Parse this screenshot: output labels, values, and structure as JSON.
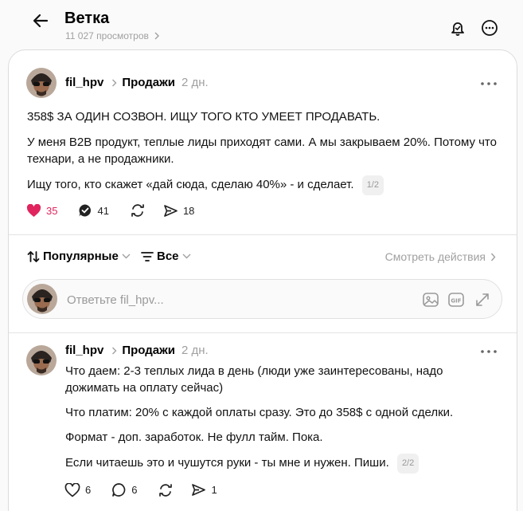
{
  "header": {
    "title": "Ветка",
    "views": "11 027 просмотров"
  },
  "post": {
    "username": "fil_hpv",
    "topic": "Продажи",
    "time": "2 дн.",
    "paragraphs": [
      "358$ ЗА ОДИН СОЗВОН. ИЩУ ТОГО КТО УМЕЕТ ПРОДАВАТЬ.",
      "У меня B2B продукт, теплые лиды приходят сами. А мы закрываем 20%. Потому что технари, а не продажники.",
      "Ищу того, кто скажет «дай сюда, сделаю 40%» - и сделает."
    ],
    "pager": "1/2",
    "likes": "35",
    "replies": "41",
    "reposts": "",
    "shares": "18"
  },
  "sort": {
    "popular_label": "Популярные",
    "filter_label": "Все",
    "see_actions_label": "Смотреть действия"
  },
  "reply_box": {
    "placeholder": "Ответьте fil_hpv..."
  },
  "reply": {
    "username": "fil_hpv",
    "topic": "Продажи",
    "time": "2 дн.",
    "paragraphs": [
      "Что даем: 2-3 теплых лида в день (люди уже заинтересованы, надо дожимать на оплату сейчас)",
      "Что платим: 20% с каждой оплаты сразу. Это до 358$ с одной сделки.",
      "Формат - доп. заработок. Не фулл тайм. Пока.",
      "Если читаешь это и чушутся руки - ты мне и нужен. Пиши."
    ],
    "pager": "2/2",
    "likes": "6",
    "replies": "6",
    "shares": "1"
  },
  "colors": {
    "like_active": "#e0245e",
    "muted": "#a0a0a0",
    "divider": "#e3e3e3"
  }
}
